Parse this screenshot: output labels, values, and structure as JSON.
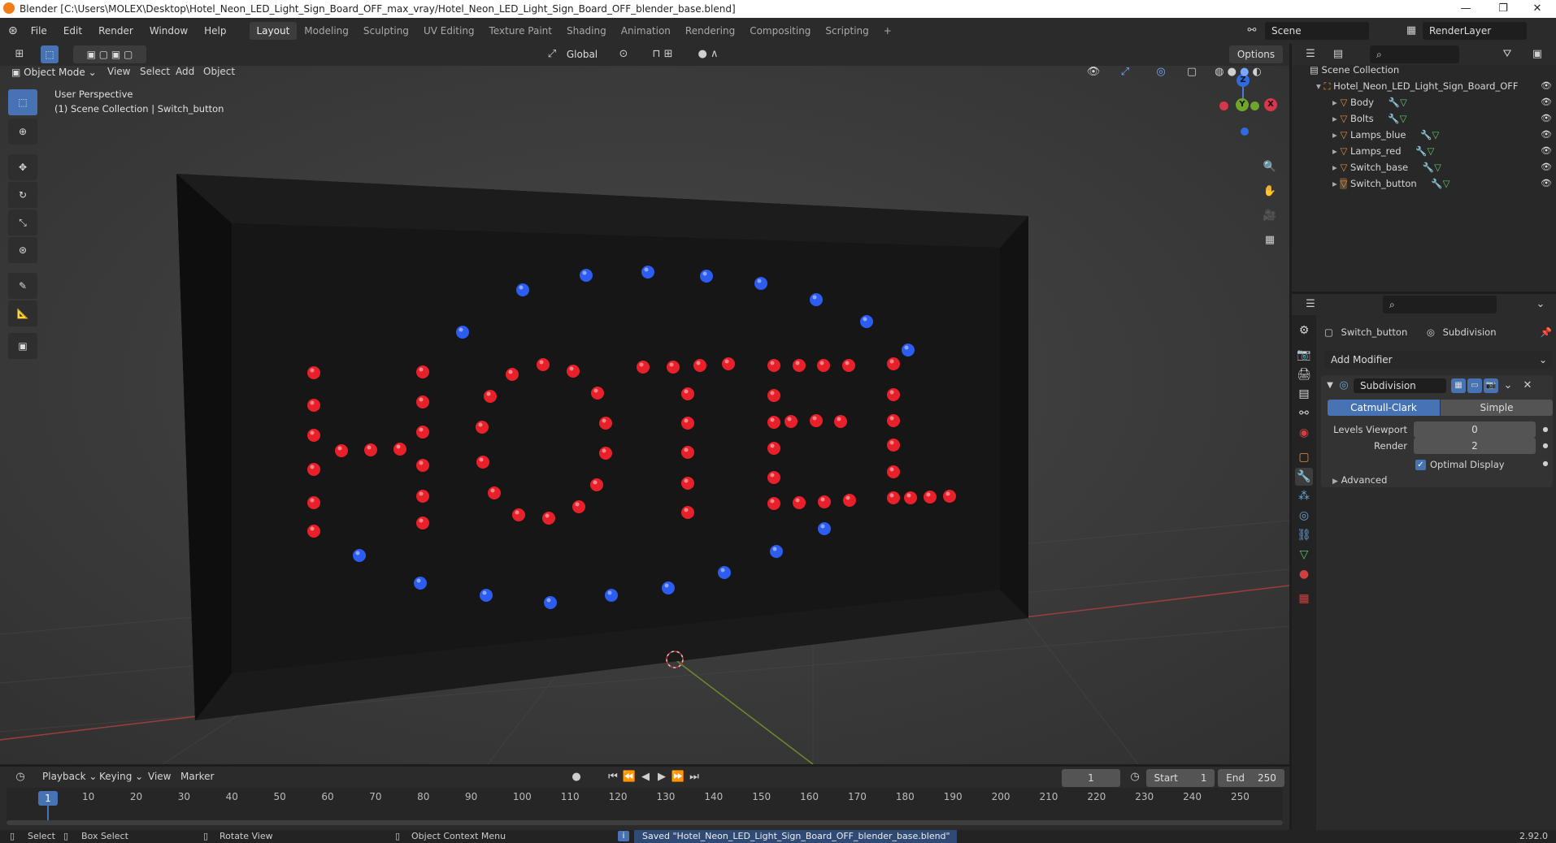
{
  "window": {
    "title": "Blender [C:\\Users\\MOLEX\\Desktop\\Hotel_Neon_LED_Light_Sign_Board_OFF_max_vray/Hotel_Neon_LED_Light_Sign_Board_OFF_blender_base.blend]"
  },
  "menus": [
    "File",
    "Edit",
    "Render",
    "Window",
    "Help"
  ],
  "workspaces": [
    "Layout",
    "Modeling",
    "Sculpting",
    "UV Editing",
    "Texture Paint",
    "Shading",
    "Animation",
    "Rendering",
    "Compositing",
    "Scripting"
  ],
  "top_right": {
    "scene": "Scene",
    "render_layer": "RenderLayer"
  },
  "viewport": {
    "mode": "Object Mode",
    "menus": [
      "View",
      "Select",
      "Add",
      "Object"
    ],
    "transform": "Global",
    "options": "Options",
    "overlay_title": "User Perspective",
    "overlay_sub": "(1) Scene Collection | Switch_button",
    "gizmo": {
      "z": "Z",
      "y": "Y",
      "x": "X"
    }
  },
  "outliner": {
    "root": "Scene Collection",
    "object": "Hotel_Neon_LED_Light_Sign_Board_OFF",
    "children": [
      "Body",
      "Bolts",
      "Lamps_blue",
      "Lamps_red",
      "Switch_base",
      "Switch_button"
    ]
  },
  "properties": {
    "object_name": "Switch_button",
    "modifier_label": "Subdivision",
    "add_modifier": "Add Modifier",
    "modifier_name": "Subdivision",
    "catmull": "Catmull-Clark",
    "simple": "Simple",
    "levels_label": "Levels Viewport",
    "levels_value": "0",
    "render_label": "Render",
    "render_value": "2",
    "optimal": "Optimal Display",
    "advanced": "Advanced"
  },
  "timeline": {
    "menus": [
      "Playback",
      "Keying",
      "View",
      "Marker"
    ],
    "current_frame": "1",
    "start_label": "Start",
    "start": "1",
    "end_label": "End",
    "end": "250",
    "ticks": [
      "1",
      "10",
      "20",
      "30",
      "40",
      "50",
      "60",
      "70",
      "80",
      "90",
      "100",
      "110",
      "120",
      "130",
      "140",
      "150",
      "160",
      "170",
      "180",
      "190",
      "200",
      "210",
      "220",
      "230",
      "240",
      "250"
    ]
  },
  "status": {
    "select": "Select",
    "box_select": "Box Select",
    "rotate": "Rotate View",
    "context": "Object Context Menu",
    "saved": "Saved \"Hotel_Neon_LED_Light_Sign_Board_OFF_blender_base.blend\"",
    "version": "2.92.0"
  },
  "colors": {
    "accent": "#4772b3",
    "led_red": "#e8202a",
    "led_blue": "#2c5cf0",
    "bg": "#3a3a3a"
  }
}
